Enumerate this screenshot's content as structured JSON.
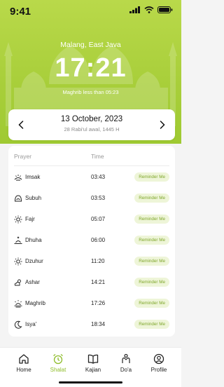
{
  "status": {
    "time": "9:41"
  },
  "header": {
    "city": "Malang, East Java",
    "clock": "17:21",
    "next_prayer": "Maghrib less than 05:23"
  },
  "date": {
    "gregorian": "13 October, 2023",
    "hijri": "28 Rabi'ul awal, 1445 H"
  },
  "table": {
    "col_prayer": "Prayer",
    "col_time": "Time",
    "rows": [
      {
        "name": "Imsak",
        "time": "03:43",
        "action": "Reminder Me",
        "icon": "imsak-icon"
      },
      {
        "name": "Subuh",
        "time": "03:53",
        "action": "Reminder Me",
        "icon": "subuh-icon"
      },
      {
        "name": "Fajr",
        "time": "05:07",
        "action": "Reminder Me",
        "icon": "sun-icon"
      },
      {
        "name": "Dhuha",
        "time": "06:00",
        "action": "Reminder Me",
        "icon": "sunrise-icon"
      },
      {
        "name": "Dzuhur",
        "time": "11:20",
        "action": "Reminder Me",
        "icon": "sun-icon"
      },
      {
        "name": "Ashar",
        "time": "14:21",
        "action": "Reminder Me",
        "icon": "cloud-sun-icon"
      },
      {
        "name": "Maghrib",
        "time": "17:26",
        "action": "Reminder Me",
        "icon": "sunset-icon"
      },
      {
        "name": "Isya'",
        "time": "18:34",
        "action": "Reminder Me",
        "icon": "moon-icon"
      }
    ]
  },
  "nav": [
    {
      "label": "Home",
      "icon": "home-icon"
    },
    {
      "label": "Shalat",
      "icon": "alarm-clock-icon",
      "active": true
    },
    {
      "label": "Kajian",
      "icon": "book-icon"
    },
    {
      "label": "Do'a",
      "icon": "pray-icon"
    },
    {
      "label": "Profile",
      "icon": "profile-icon"
    }
  ],
  "colors": {
    "accent": "#a9cf3b",
    "reminder_bg": "#eef5d8",
    "reminder_text": "#7ea62a"
  }
}
